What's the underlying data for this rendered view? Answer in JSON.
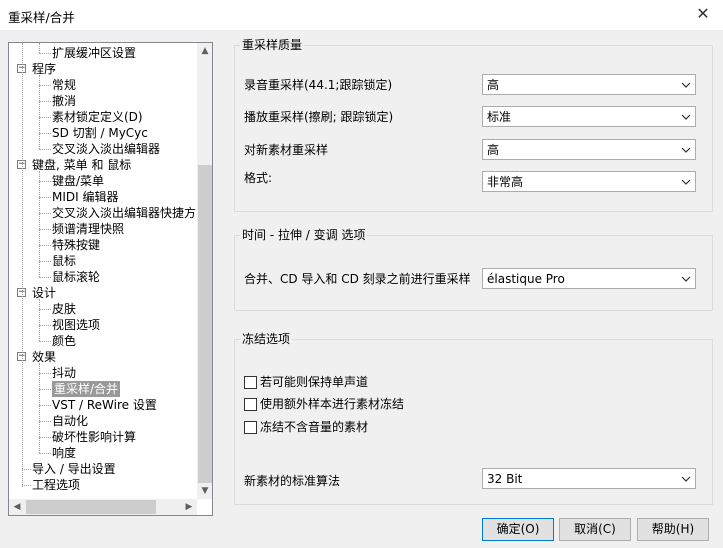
{
  "window": {
    "title": "重采样/合并"
  },
  "tree": {
    "items": [
      {
        "label": "扩展缓冲区设置",
        "level": 1,
        "selected": false
      },
      {
        "label": "程序",
        "level": 0,
        "selected": false
      },
      {
        "label": "常规",
        "level": 1,
        "selected": false
      },
      {
        "label": "撤消",
        "level": 1,
        "selected": false
      },
      {
        "label": "素材锁定定义(D)",
        "level": 1,
        "selected": false
      },
      {
        "label": "SD 切割 / MyCyc",
        "level": 1,
        "selected": false
      },
      {
        "label": "交叉淡入淡出编辑器",
        "level": 1,
        "selected": false
      },
      {
        "label": "键盘, 菜单 和 鼠标",
        "level": 0,
        "selected": false
      },
      {
        "label": "键盘/菜单",
        "level": 1,
        "selected": false
      },
      {
        "label": "MIDI 编辑器",
        "level": 1,
        "selected": false
      },
      {
        "label": "交叉淡入淡出编辑器快捷方",
        "level": 1,
        "selected": false
      },
      {
        "label": "频谱清理快照",
        "level": 1,
        "selected": false
      },
      {
        "label": "特殊按键",
        "level": 1,
        "selected": false
      },
      {
        "label": "鼠标",
        "level": 1,
        "selected": false
      },
      {
        "label": "鼠标滚轮",
        "level": 1,
        "selected": false
      },
      {
        "label": "设计",
        "level": 0,
        "selected": false
      },
      {
        "label": "皮肤",
        "level": 1,
        "selected": false
      },
      {
        "label": "视图选项",
        "level": 1,
        "selected": false
      },
      {
        "label": "颜色",
        "level": 1,
        "selected": false
      },
      {
        "label": "效果",
        "level": 0,
        "selected": false
      },
      {
        "label": "抖动",
        "level": 1,
        "selected": false
      },
      {
        "label": "重采样/合并",
        "level": 1,
        "selected": true
      },
      {
        "label": "VST / ReWire 设置",
        "level": 1,
        "selected": false
      },
      {
        "label": "自动化",
        "level": 1,
        "selected": false
      },
      {
        "label": "破坏性影响计算",
        "level": 1,
        "selected": false
      },
      {
        "label": "响度",
        "level": 1,
        "selected": false
      },
      {
        "label": "导入 / 导出设置",
        "level": 0,
        "selected": false
      },
      {
        "label": "工程选项",
        "level": 0,
        "selected": false
      }
    ]
  },
  "resample_quality": {
    "title": "重采样质量",
    "rows": [
      {
        "label": "录音重采样(44.1;跟踪锁定)",
        "value": "高"
      },
      {
        "label": "播放重采样(擦刷; 跟踪锁定)",
        "value": "标准"
      },
      {
        "label": "对新素材重采样",
        "value": "高"
      },
      {
        "label": "格式:",
        "value": "非常高"
      }
    ]
  },
  "time_stretch": {
    "title": "时间 - 拉伸 /  变调 选项",
    "row": {
      "label": "合并、CD 导入和 CD 刻录之前进行重采样",
      "value": "élastique Pro"
    }
  },
  "freeze": {
    "title": "冻结选项",
    "checks": [
      {
        "label": "若可能则保持单声道",
        "checked": false
      },
      {
        "label": "使用额外样本进行素材冻结",
        "checked": false
      },
      {
        "label": "冻结不含音量的素材",
        "checked": false
      }
    ],
    "algo": {
      "label": "新素材的标准算法",
      "value": "32 Bit"
    }
  },
  "buttons": {
    "ok": "确定(O)",
    "cancel": "取消(C)",
    "help": "帮助(H)"
  },
  "icons": {
    "close": "close-icon",
    "expand": "minus-expander-icon",
    "dropdown": "chevron-down-icon"
  }
}
